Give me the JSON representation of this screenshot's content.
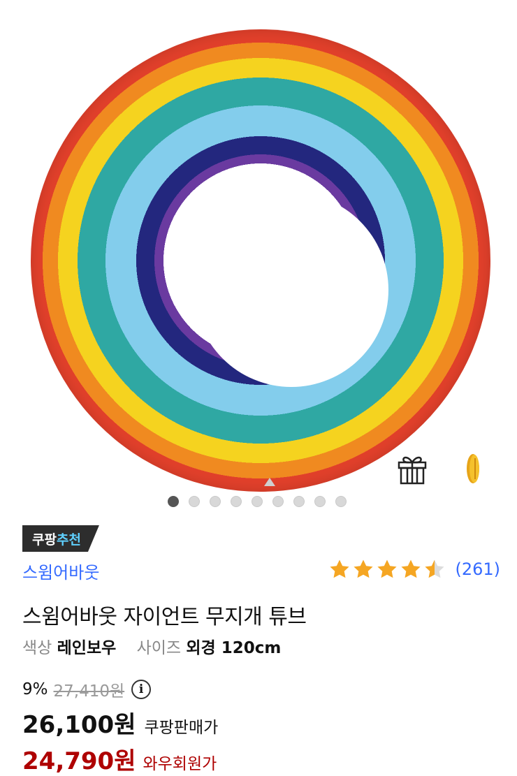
{
  "badge": {
    "prefix": "쿠팡",
    "accent": "추천"
  },
  "brand": "스윔어바웃",
  "rating": {
    "stars": 4.5,
    "max": 5,
    "count_text": "(261)"
  },
  "title": "스윔어바웃 자이언트 무지개 튜브",
  "options": {
    "color_label": "색상",
    "color_value": "레인보우",
    "size_label": "사이즈",
    "size_value": "외경 120cm"
  },
  "pricing": {
    "discount": "9%",
    "original": "27,410원",
    "info_symbol": "i",
    "sale_price": "26,100원",
    "sale_label": "쿠팡판매가",
    "wow_price": "24,790원",
    "wow_label": "와우회원가"
  },
  "gallery": {
    "image_count": 9,
    "active_index": 0
  },
  "colors": {
    "link": "#346aff",
    "star": "#f5a623",
    "wow": "#ae0000",
    "badge_bg": "#2d2d2d",
    "badge_accent": "#5fd0ff"
  },
  "icons": [
    "gift-icon",
    "coin-icon",
    "star-icon",
    "info-icon"
  ]
}
